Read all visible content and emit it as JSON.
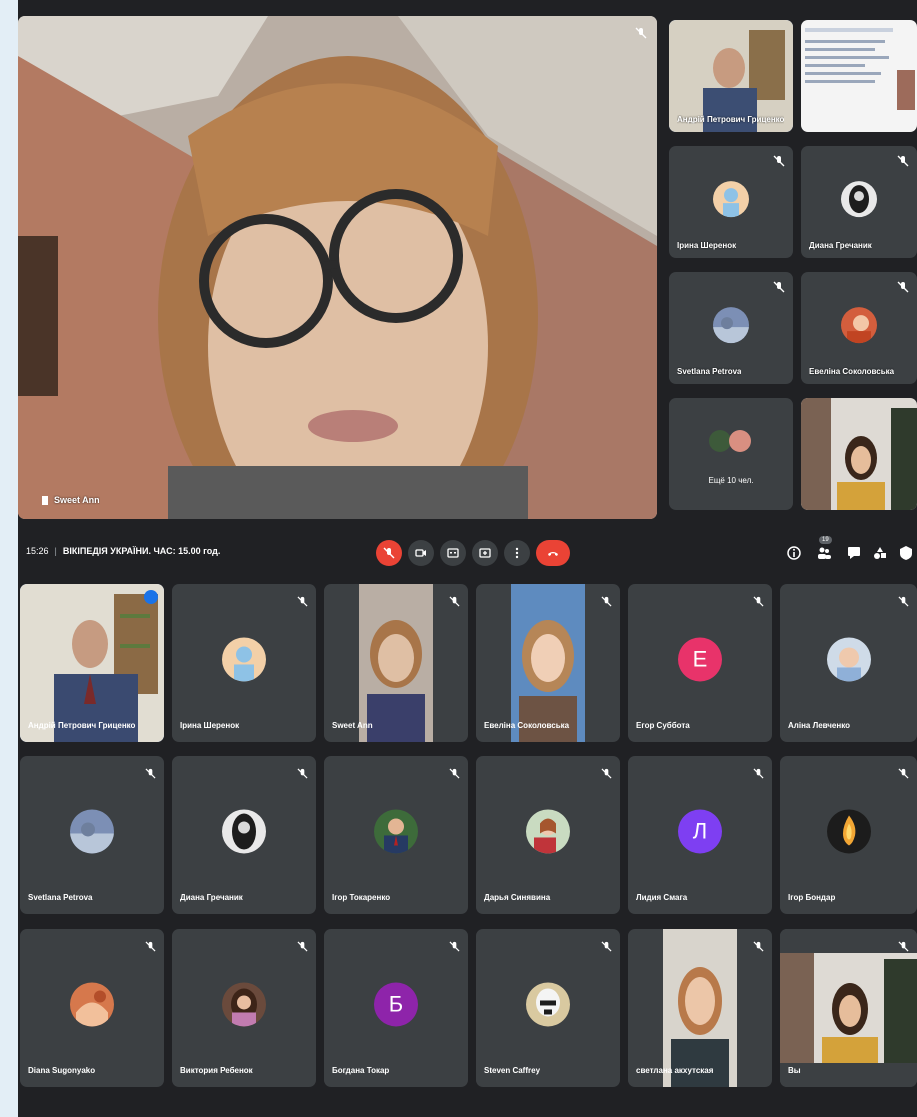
{
  "meeting": {
    "time": "15:26",
    "title": "ВІКІПЕДІЯ УКРАЇНИ. ЧАС: 15.00 год.",
    "people_badge": "19"
  },
  "main_speaker": {
    "name": "Sweet Ann"
  },
  "sidebar_tiles": [
    {
      "name": "Андрій Петрович Гриценко"
    },
    {
      "name": ""
    },
    {
      "name": "Ірина Шеренок"
    },
    {
      "name": "Диана Гречаник"
    },
    {
      "name": "Svetlana Petrova"
    },
    {
      "name": "Евеліна Соколовська"
    },
    {
      "name": "Ещё 10 чел."
    },
    {
      "name": ""
    }
  ],
  "grid": [
    {
      "name": "Андрій Петрович Гриценко"
    },
    {
      "name": "Ірина Шеренок"
    },
    {
      "name": "Sweet Ann"
    },
    {
      "name": "Евеліна Соколовська"
    },
    {
      "name": "Егор Суббота",
      "letter": "E",
      "color": "#e8336a"
    },
    {
      "name": "Аліна Левченко"
    },
    {
      "name": "Svetlana Petrova"
    },
    {
      "name": "Диана Гречаник"
    },
    {
      "name": "Ігор Токаренко"
    },
    {
      "name": "Дарья Синявина"
    },
    {
      "name": "Лидия Смага",
      "letter": "Л",
      "color": "#7e3ff2"
    },
    {
      "name": "Ігор Бондар"
    },
    {
      "name": "Diana Sugonyako"
    },
    {
      "name": "Виктория Ребенок"
    },
    {
      "name": "Богдана Токар",
      "letter": "Б",
      "color": "#8e24aa"
    },
    {
      "name": "Steven Caffrey"
    },
    {
      "name": "светлана акхутская"
    },
    {
      "name": "Вы"
    }
  ],
  "colors": {
    "background": "#202124",
    "tile": "#3c4043",
    "end_call": "#ea4335",
    "active_outline": "#8ab4f8"
  }
}
